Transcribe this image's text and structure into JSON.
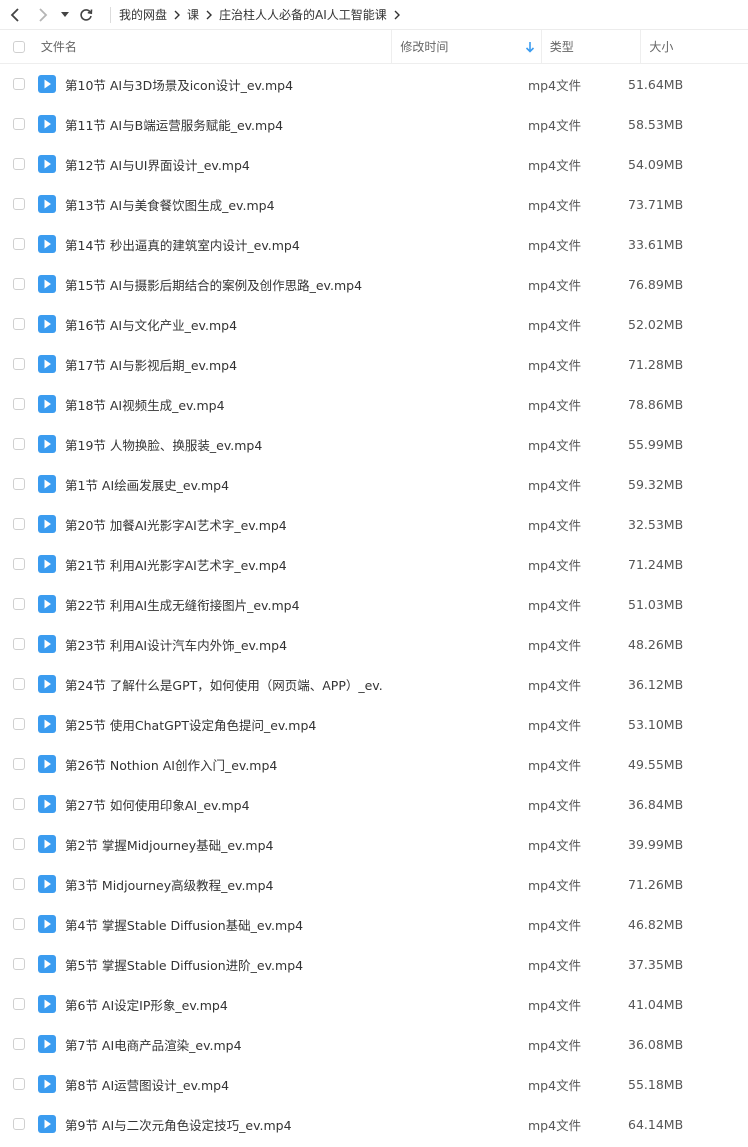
{
  "breadcrumb": [
    "我的网盘",
    "课",
    "庄治柱人人必备的AI人工智能课"
  ],
  "columns": {
    "name": "文件名",
    "modified": "修改时间",
    "type": "类型",
    "size": "大小"
  },
  "colors": {
    "accent": "#3b9cf0",
    "icon_bg": "#3b9cf0"
  },
  "files": [
    {
      "name": "第10节 AI与3D场景及icon设计_ev.mp4",
      "type": "mp4文件",
      "size": "51.64MB"
    },
    {
      "name": "第11节 AI与B端运营服务赋能_ev.mp4",
      "type": "mp4文件",
      "size": "58.53MB"
    },
    {
      "name": "第12节 AI与UI界面设计_ev.mp4",
      "type": "mp4文件",
      "size": "54.09MB"
    },
    {
      "name": "第13节 AI与美食餐饮图生成_ev.mp4",
      "type": "mp4文件",
      "size": "73.71MB"
    },
    {
      "name": "第14节 秒出逼真的建筑室内设计_ev.mp4",
      "type": "mp4文件",
      "size": "33.61MB"
    },
    {
      "name": "第15节 AI与摄影后期结合的案例及创作思路_ev.mp4",
      "type": "mp4文件",
      "size": "76.89MB"
    },
    {
      "name": "第16节 AI与文化产业_ev.mp4",
      "type": "mp4文件",
      "size": "52.02MB"
    },
    {
      "name": "第17节 AI与影视后期_ev.mp4",
      "type": "mp4文件",
      "size": "71.28MB"
    },
    {
      "name": "第18节 AI视频生成_ev.mp4",
      "type": "mp4文件",
      "size": "78.86MB"
    },
    {
      "name": "第19节 人物换脸、换服装_ev.mp4",
      "type": "mp4文件",
      "size": "55.99MB"
    },
    {
      "name": "第1节 AI绘画发展史_ev.mp4",
      "type": "mp4文件",
      "size": "59.32MB"
    },
    {
      "name": "第20节 加餐AI光影字AI艺术字_ev.mp4",
      "type": "mp4文件",
      "size": "32.53MB"
    },
    {
      "name": "第21节 利用AI光影字AI艺术字_ev.mp4",
      "type": "mp4文件",
      "size": "71.24MB"
    },
    {
      "name": "第22节 利用AI生成无缝衔接图片_ev.mp4",
      "type": "mp4文件",
      "size": "51.03MB"
    },
    {
      "name": "第23节 利用AI设计汽车内外饰_ev.mp4",
      "type": "mp4文件",
      "size": "48.26MB"
    },
    {
      "name": "第24节 了解什么是GPT，如何使用（网页端、APP）_ev....",
      "type": "mp4文件",
      "size": "36.12MB"
    },
    {
      "name": "第25节 使用ChatGPT设定角色提问_ev.mp4",
      "type": "mp4文件",
      "size": "53.10MB"
    },
    {
      "name": "第26节 Nothion AI创作入门_ev.mp4",
      "type": "mp4文件",
      "size": "49.55MB"
    },
    {
      "name": "第27节 如何使用印象AI_ev.mp4",
      "type": "mp4文件",
      "size": "36.84MB"
    },
    {
      "name": "第2节 掌握Midjourney基础_ev.mp4",
      "type": "mp4文件",
      "size": "39.99MB"
    },
    {
      "name": "第3节 Midjourney高级教程_ev.mp4",
      "type": "mp4文件",
      "size": "71.26MB"
    },
    {
      "name": "第4节 掌握Stable Diffusion基础_ev.mp4",
      "type": "mp4文件",
      "size": "46.82MB"
    },
    {
      "name": "第5节 掌握Stable Diffusion进阶_ev.mp4",
      "type": "mp4文件",
      "size": "37.35MB"
    },
    {
      "name": "第6节 AI设定IP形象_ev.mp4",
      "type": "mp4文件",
      "size": "41.04MB"
    },
    {
      "name": "第7节 AI电商产品渲染_ev.mp4",
      "type": "mp4文件",
      "size": "36.08MB"
    },
    {
      "name": "第8节 AI运营图设计_ev.mp4",
      "type": "mp4文件",
      "size": "55.18MB"
    },
    {
      "name": "第9节 AI与二次元角色设定技巧_ev.mp4",
      "type": "mp4文件",
      "size": "64.14MB"
    }
  ]
}
